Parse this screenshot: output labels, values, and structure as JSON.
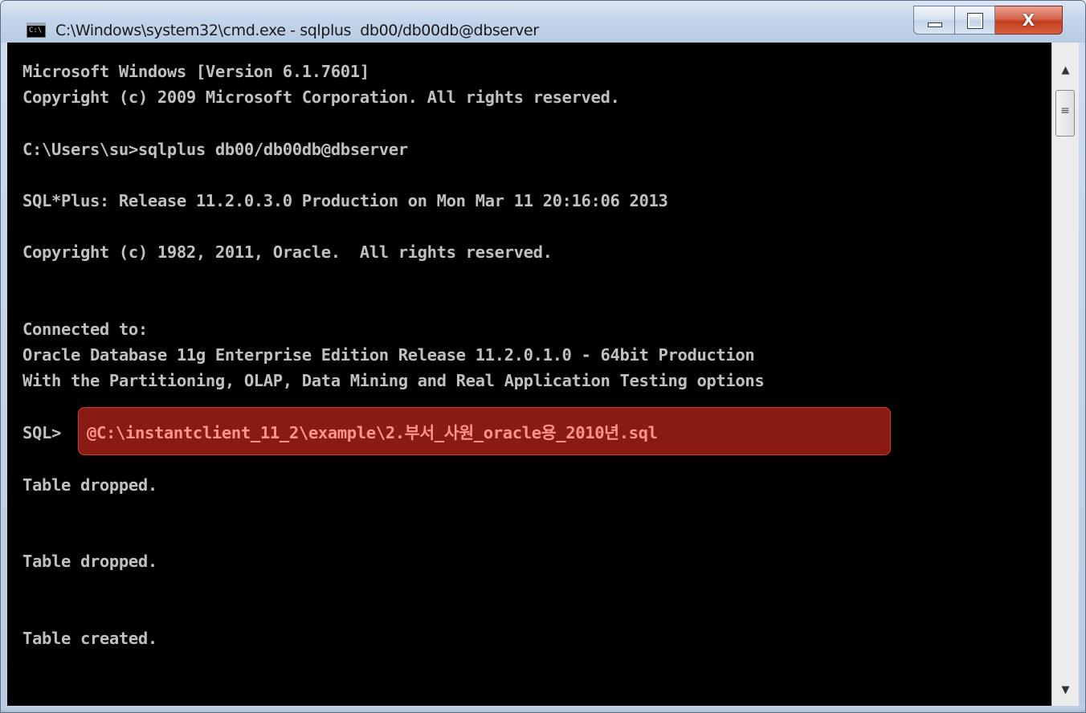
{
  "window": {
    "title": "C:\\Windows\\system32\\cmd.exe - sqlplus  db00/db00db@dbserver",
    "icon": "cmd-icon",
    "icon_text": "C:\\",
    "minimize_icon": "minimize-icon",
    "maximize_icon": "maximize-icon",
    "close_icon": "close-icon",
    "close_glyph": "X"
  },
  "console": {
    "lines": [
      "Microsoft Windows [Version 6.1.7601]",
      "Copyright (c) 2009 Microsoft Corporation. All rights reserved.",
      "C:\\Users\\su>sqlplus db00/db00db@dbserver",
      "SQL*Plus: Release 11.2.0.3.0 Production on Mon Mar 11 20:16:06 2013",
      "Copyright (c) 1982, 2011, Oracle.  All rights reserved.",
      "Connected to:",
      "Oracle Database 11g Enterprise Edition Release 11.2.0.1.0 - 64bit Production",
      "With the Partitioning, OLAP, Data Mining and Real Application Testing options",
      "Table dropped.",
      "Table dropped.",
      "Table created."
    ],
    "prompt": "SQL>",
    "command": "@C:\\instantclient_11_2\\example\\2.부서_사원_oracle용_2010년.sql",
    "highlight_color": "#8a1b14"
  },
  "scrollbar": {
    "up_icon": "scroll-up-arrow-icon",
    "down_icon": "scroll-down-arrow-icon",
    "up_glyph": "▲",
    "down_glyph": "▼",
    "grip_glyph": "≡"
  }
}
